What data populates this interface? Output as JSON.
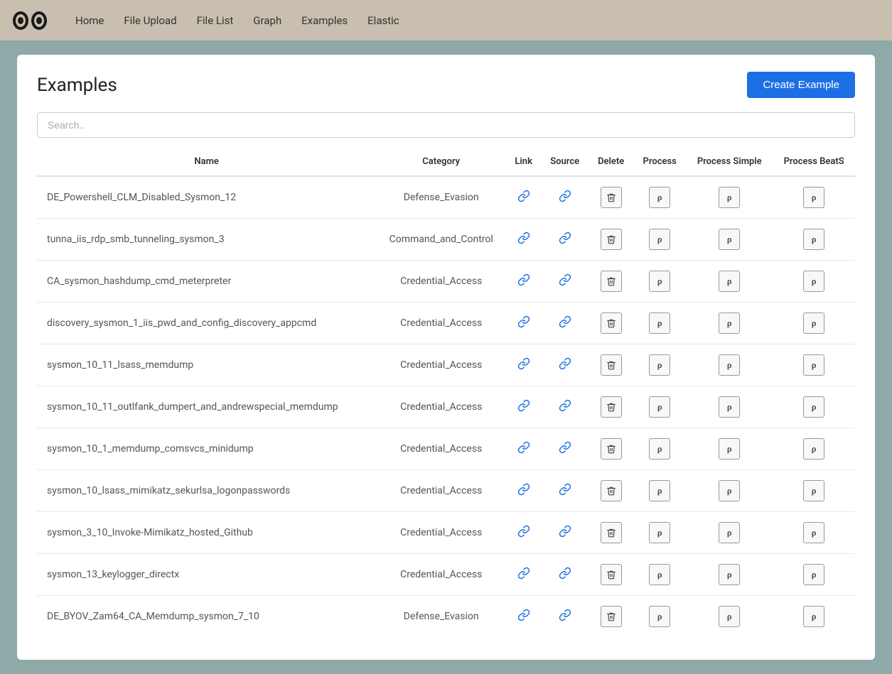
{
  "navbar": {
    "links": [
      {
        "label": "Home",
        "id": "home"
      },
      {
        "label": "File Upload",
        "id": "file-upload"
      },
      {
        "label": "File List",
        "id": "file-list"
      },
      {
        "label": "Graph",
        "id": "graph"
      },
      {
        "label": "Examples",
        "id": "examples"
      },
      {
        "label": "Elastic",
        "id": "elastic"
      }
    ]
  },
  "page": {
    "title": "Examples",
    "create_button": "Create Example",
    "search_placeholder": "Search.."
  },
  "table": {
    "headers": {
      "name": "Name",
      "category": "Category",
      "link": "Link",
      "source": "Source",
      "delete": "Delete",
      "process": "Process",
      "process_simple": "Process Simple",
      "process_beats": "Process BeatS"
    },
    "rows": [
      {
        "name": "DE_Powershell_CLM_Disabled_Sysmon_12",
        "category": "Defense_Evasion"
      },
      {
        "name": "tunna_iis_rdp_smb_tunneling_sysmon_3",
        "category": "Command_and_Control"
      },
      {
        "name": "CA_sysmon_hashdump_cmd_meterpreter",
        "category": "Credential_Access"
      },
      {
        "name": "discovery_sysmon_1_iis_pwd_and_config_discovery_appcmd",
        "category": "Credential_Access"
      },
      {
        "name": "sysmon_10_11_lsass_memdump",
        "category": "Credential_Access"
      },
      {
        "name": "sysmon_10_11_outlfank_dumpert_and_andrewspecial_memdump",
        "category": "Credential_Access"
      },
      {
        "name": "sysmon_10_1_memdump_comsvcs_minidump",
        "category": "Credential_Access"
      },
      {
        "name": "sysmon_10_lsass_mimikatz_sekurlsa_logonpasswords",
        "category": "Credential_Access"
      },
      {
        "name": "sysmon_3_10_Invoke-Mimikatz_hosted_Github",
        "category": "Credential_Access"
      },
      {
        "name": "sysmon_13_keylogger_directx",
        "category": "Credential_Access"
      },
      {
        "name": "DE_BYOV_Zam64_CA_Memdump_sysmon_7_10",
        "category": "Defense_Evasion"
      }
    ]
  },
  "icons": {
    "link": "🔗",
    "delete": "🗑",
    "process": "ρ"
  }
}
